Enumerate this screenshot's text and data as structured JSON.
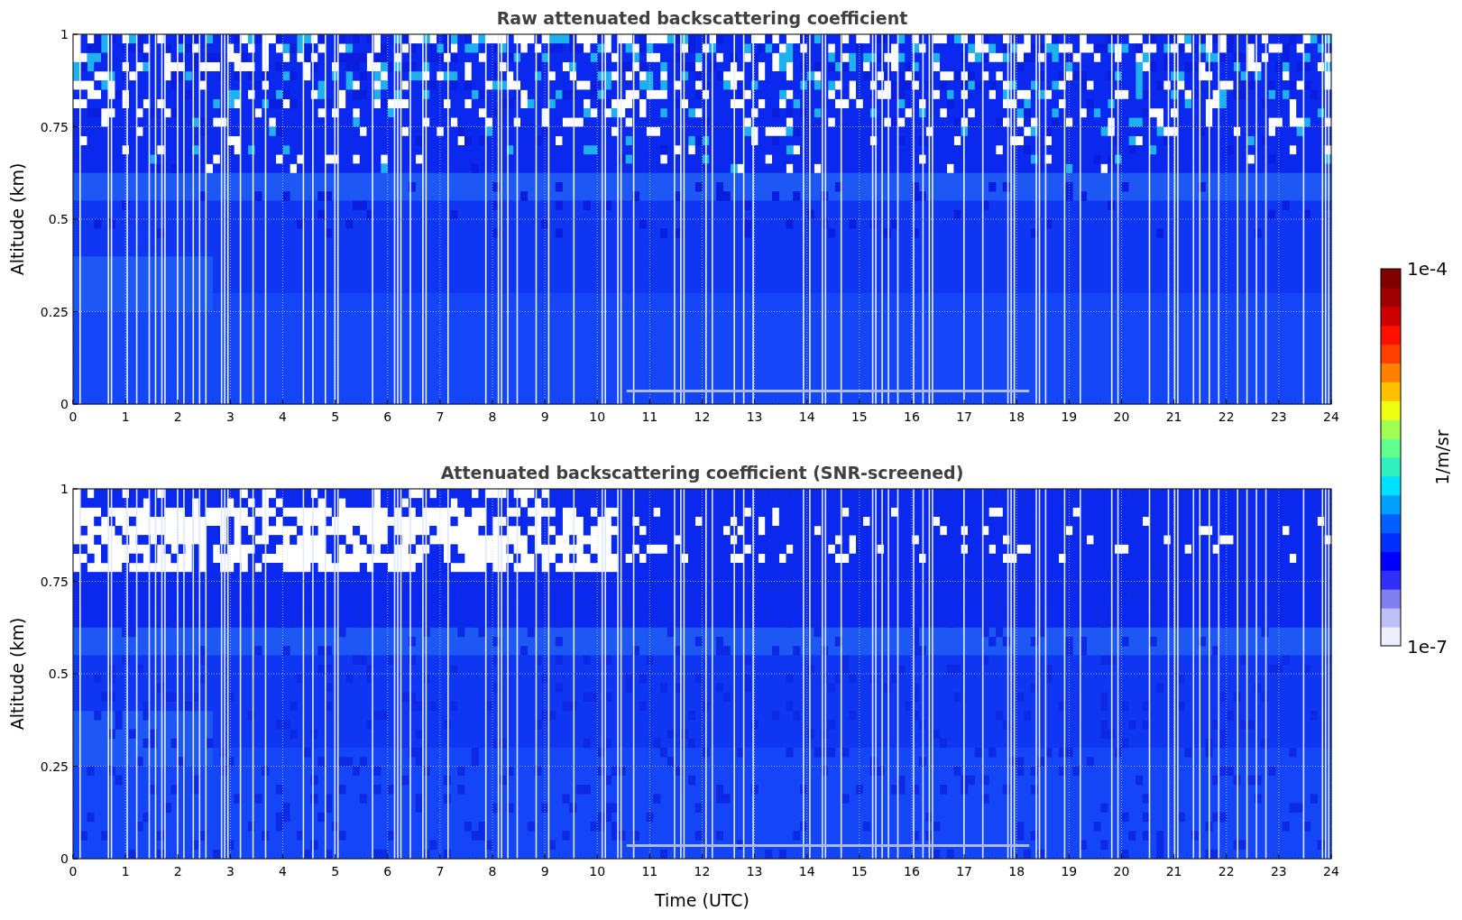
{
  "panels": [
    {
      "kind": "raw",
      "title": "Raw attenuated backscattering coefficient",
      "ylabel": "Altitude (km)",
      "yticks": [
        "1",
        "0.75",
        "0.5",
        "0.25",
        "0"
      ],
      "xticks": [
        "0",
        "1",
        "2",
        "3",
        "4",
        "5",
        "6",
        "7",
        "8",
        "9",
        "10",
        "11",
        "12",
        "13",
        "14",
        "15",
        "16",
        "17",
        "18",
        "19",
        "20",
        "21",
        "22",
        "23",
        "24"
      ]
    },
    {
      "kind": "screened",
      "title": "Attenuated backscattering coefficient (SNR-screened)",
      "ylabel": "Altitude (km)",
      "yticks": [
        "1",
        "0.75",
        "0.5",
        "0.25",
        "0"
      ],
      "xticks": [
        "0",
        "1",
        "2",
        "3",
        "4",
        "5",
        "6",
        "7",
        "8",
        "9",
        "10",
        "11",
        "12",
        "13",
        "14",
        "15",
        "16",
        "17",
        "18",
        "19",
        "20",
        "21",
        "22",
        "23",
        "24"
      ]
    }
  ],
  "xlabel": "Time (UTC)",
  "colorbar": {
    "label": "1/m/sr",
    "max": "1e-4",
    "min": "1e-7"
  }
}
